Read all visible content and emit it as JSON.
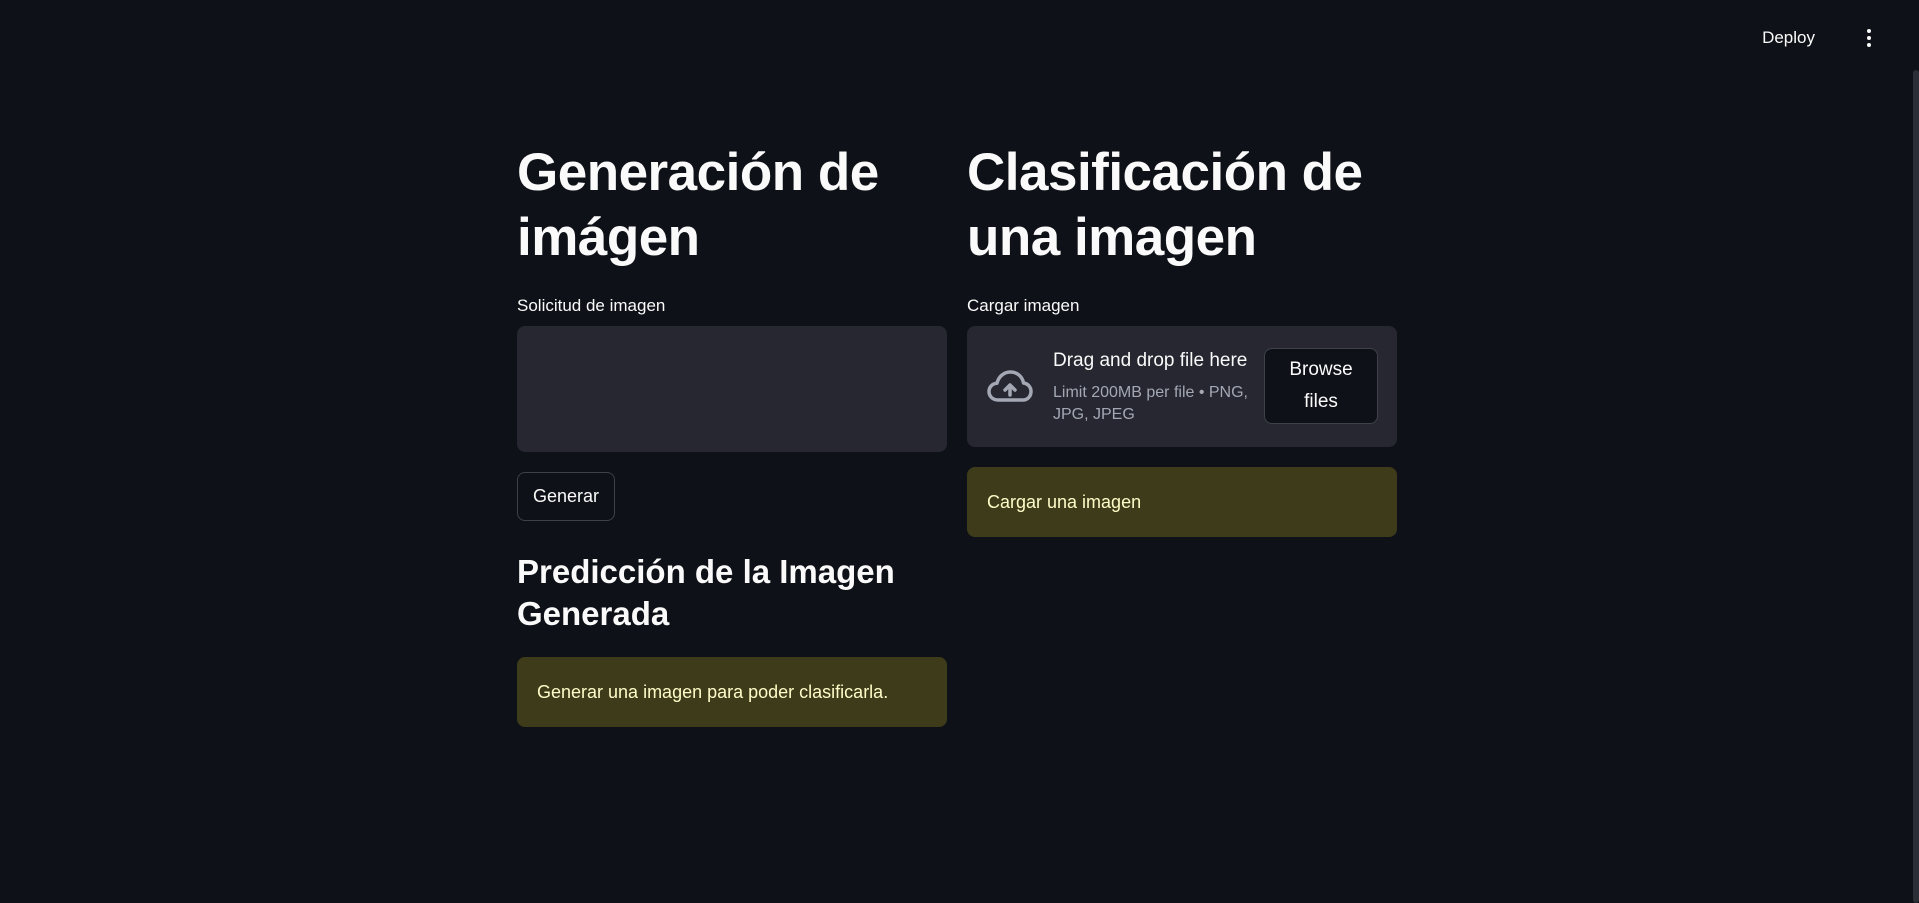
{
  "header": {
    "deploy_label": "Deploy",
    "menu_icon": "kebab-menu-icon"
  },
  "left": {
    "title": "Generación de imágen",
    "prompt_label": "Solicitud de imagen",
    "prompt_value": "",
    "generate_label": "Generar",
    "prediction_title": "Predicción de la Imagen Generada",
    "prediction_alert": "Generar una imagen para poder clasificarla."
  },
  "right": {
    "title": "Clasificación de una imagen",
    "upload_label": "Cargar imagen",
    "upload_icon": "cloud-upload-icon",
    "drop_text": "Drag and drop file here",
    "limit_text": "Limit 200MB per file • PNG, JPG, JPEG",
    "browse_label": "Browse files",
    "alert_text": "Cargar una imagen"
  },
  "colors": {
    "background": "#0e1117",
    "input_bg": "#262730",
    "warning_bg": "#3d3b19",
    "warning_text": "#fffbc8"
  }
}
